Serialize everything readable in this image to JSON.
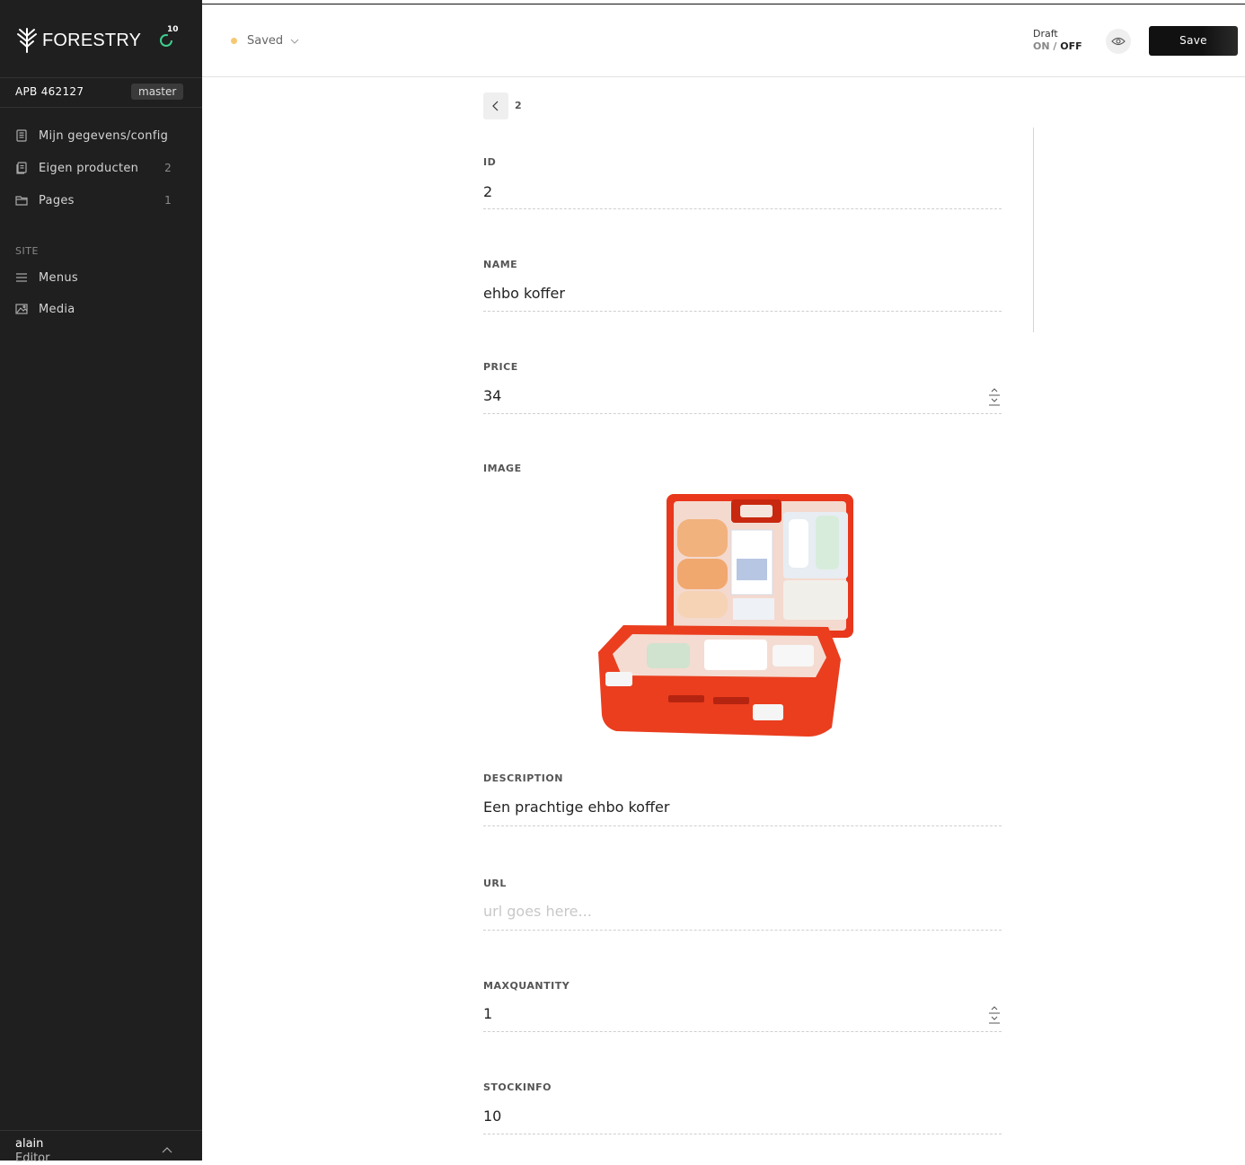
{
  "app": {
    "brand": "FORESTRY",
    "sync_count": "10"
  },
  "sidebar": {
    "site_name": "APB 462127",
    "branch": "master",
    "items": [
      {
        "label": "Mijn gegevens/config",
        "count": ""
      },
      {
        "label": "Eigen producten",
        "count": "2"
      },
      {
        "label": "Pages",
        "count": "1"
      }
    ],
    "site_section": "SITE",
    "site_items": [
      {
        "label": "Menus"
      },
      {
        "label": "Media"
      }
    ],
    "user": {
      "name": "alain",
      "role": "Editor"
    }
  },
  "header": {
    "status": "Saved",
    "draft_label": "Draft",
    "draft_on": "ON",
    "draft_sep": "/",
    "draft_off": "OFF",
    "save_label": "Save",
    "status_color": "#f7c873"
  },
  "breadcrumb": {
    "current": "2"
  },
  "fields": {
    "id": {
      "label": "ID",
      "value": "2"
    },
    "name": {
      "label": "NAME",
      "value": "ehbo koffer"
    },
    "price": {
      "label": "PRICE",
      "value": "34"
    },
    "image": {
      "label": "IMAGE"
    },
    "description": {
      "label": "DESCRIPTION",
      "value": "Een prachtige ehbo koffer"
    },
    "url": {
      "label": "URL",
      "value": "",
      "placeholder": "url goes here..."
    },
    "maxquantity": {
      "label": "MAXQUANTITY",
      "value": "1"
    },
    "stockinfo": {
      "label": "STOCKINFO",
      "value": "10"
    }
  }
}
